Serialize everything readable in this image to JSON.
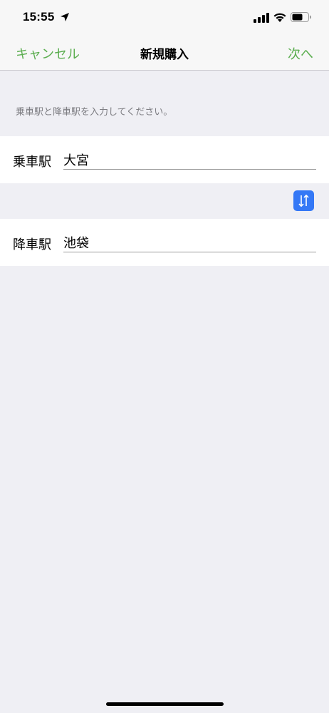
{
  "status_bar": {
    "time": "15:55",
    "icons": [
      "location-arrow-icon",
      "cellular-signal-icon",
      "wifi-icon",
      "battery-icon"
    ]
  },
  "nav": {
    "cancel_label": "キャンセル",
    "title": "新規購入",
    "next_label": "次へ"
  },
  "form": {
    "instruction": "乗車駅と降車駅を入力してください。",
    "departure": {
      "label": "乗車駅",
      "value": "大宮"
    },
    "arrival": {
      "label": "降車駅",
      "value": "池袋"
    },
    "swap_icon": "swap-arrows-icon"
  },
  "colors": {
    "accent_green": "#5cae50",
    "swap_blue": "#3478f6",
    "background": "#efeff4"
  }
}
